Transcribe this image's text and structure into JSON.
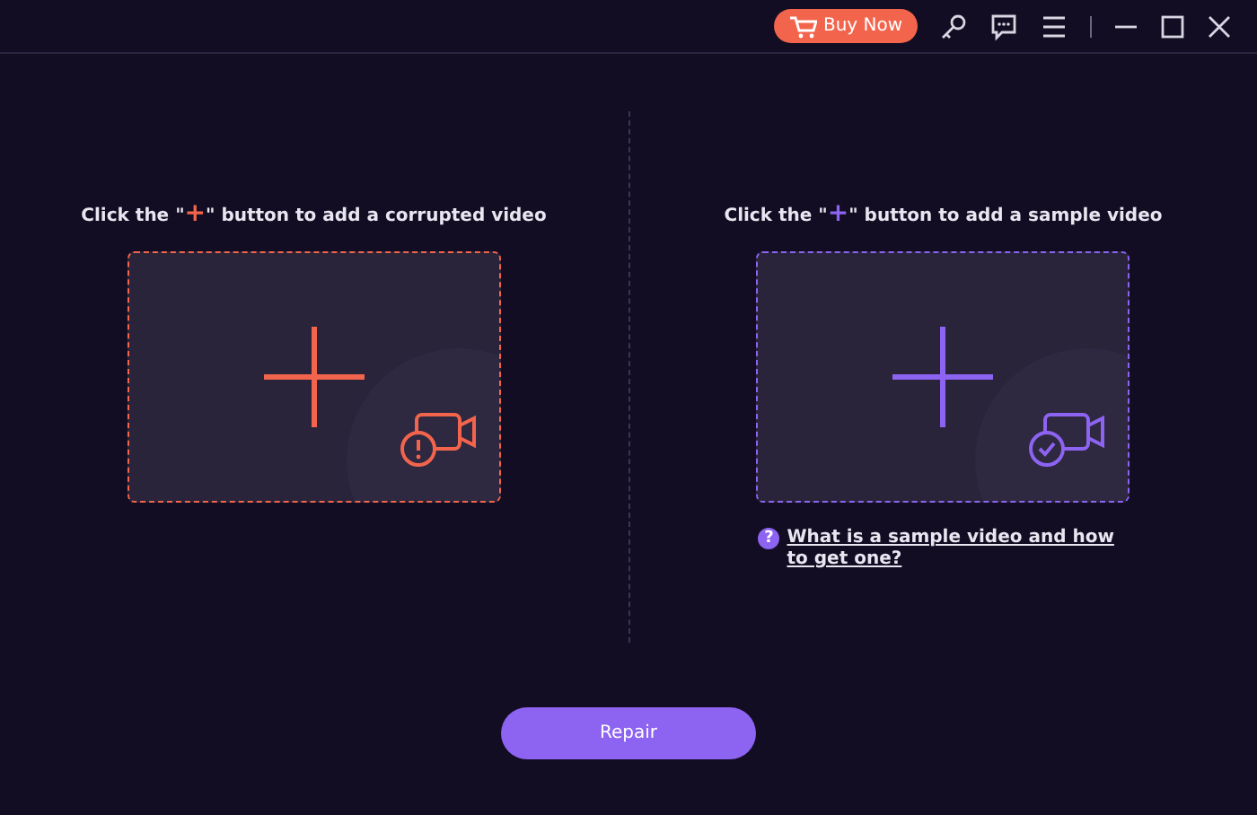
{
  "title_bar": {
    "buy_button": "Buy Now"
  },
  "panels": [
    {
      "kind": "corrupted",
      "color": "#f2654c",
      "instruction_before": "Click the \"",
      "plus_sign": "+",
      "instruction_after": "\" button to add a corrupted video"
    },
    {
      "kind": "sample",
      "color": "#8d63f2",
      "instruction_before": "Click the \"",
      "plus_sign": "+",
      "instruction_after": "\" button to add a sample video",
      "help_icon": "?",
      "help_link": "What is a sample video and how to get one?"
    }
  ],
  "repair_button": "Repair"
}
